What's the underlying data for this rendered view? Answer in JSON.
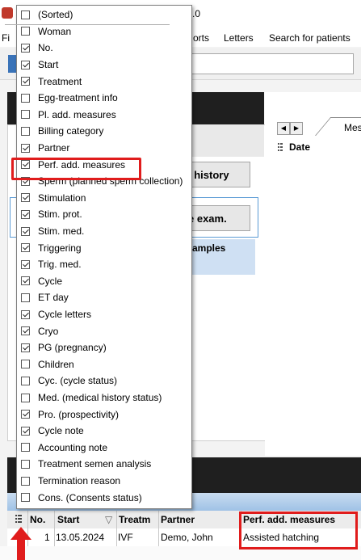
{
  "window": {
    "title_fragment": ".0"
  },
  "menu": {
    "items": [
      "Fi",
      "orts",
      "Letters",
      "Search for patients"
    ]
  },
  "buttons": {
    "history": "l history",
    "exam": "e exam."
  },
  "samples_label": "amples",
  "right_panel": {
    "tab_label": "Mes",
    "date_column": "Date"
  },
  "column_chooser": {
    "items": [
      {
        "label": "(Sorted)",
        "checked": false
      },
      {
        "label": "Woman",
        "checked": false
      },
      {
        "label": "No.",
        "checked": true
      },
      {
        "label": "Start",
        "checked": true
      },
      {
        "label": "Treatment",
        "checked": true
      },
      {
        "label": "Egg-treatment info",
        "checked": false
      },
      {
        "label": "Pl. add. measures",
        "checked": false
      },
      {
        "label": "Billing category",
        "checked": false
      },
      {
        "label": "Partner",
        "checked": true
      },
      {
        "label": "Perf. add. measures",
        "checked": true
      },
      {
        "label": "Sperm (planned sperm collection)",
        "checked": true
      },
      {
        "label": "Stimulation",
        "checked": true
      },
      {
        "label": "Stim. prot.",
        "checked": true
      },
      {
        "label": "Stim. med.",
        "checked": true
      },
      {
        "label": "Triggering",
        "checked": true
      },
      {
        "label": "Trig. med.",
        "checked": true
      },
      {
        "label": "Cycle",
        "checked": true
      },
      {
        "label": "ET day",
        "checked": false
      },
      {
        "label": "Cycle letters",
        "checked": true
      },
      {
        "label": "Cryo",
        "checked": true
      },
      {
        "label": "PG (pregnancy)",
        "checked": true
      },
      {
        "label": "Children",
        "checked": false
      },
      {
        "label": "Cyc. (cycle status)",
        "checked": false
      },
      {
        "label": "Med. (medical history status)",
        "checked": false
      },
      {
        "label": "Pro. (prospectivity)",
        "checked": true
      },
      {
        "label": "Cycle note",
        "checked": true
      },
      {
        "label": "Accounting note",
        "checked": false
      },
      {
        "label": "Treatment semen analysis",
        "checked": false
      },
      {
        "label": "Termination reason",
        "checked": false
      },
      {
        "label": "Cons. (Consents status)",
        "checked": false
      }
    ]
  },
  "grid": {
    "headers": [
      "No.",
      "Start",
      "Treatm",
      "Partner",
      "Perf. add. measures"
    ],
    "row": [
      "1",
      "13.05.2024",
      "IVF",
      "Demo, John",
      "Assisted hatching"
    ]
  },
  "colors": {
    "highlight": "#e01c1c",
    "accent_blue": "#5b9bd5"
  }
}
